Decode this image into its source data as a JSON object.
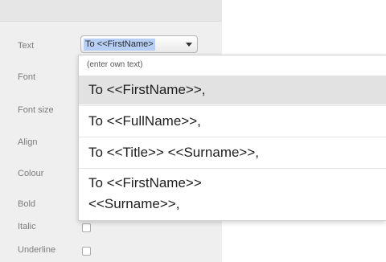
{
  "panel": {
    "labels": {
      "text": "Text",
      "font": "Font",
      "font_size": "Font size",
      "align": "Align",
      "colour": "Colour",
      "bold": "Bold",
      "italic": "Italic",
      "underline": "Underline"
    },
    "text_select": {
      "value": "To <<FirstName>"
    },
    "checkboxes": {
      "italic": false,
      "underline": false
    }
  },
  "dropdown": {
    "options": [
      "(enter own text)",
      "To <<FirstName>>,",
      "To <<FullName>>,",
      "To <<Title>> <<Surname>>,"
    ],
    "option_multiline": {
      "line1": "To <<FirstName>>",
      "line2": "<<Surname>>,"
    },
    "highlighted_index": 1
  },
  "colors": {
    "panel_bg": "#efefef",
    "selection_bg": "#b7cff5",
    "highlight_row": "#e2e2e2"
  }
}
